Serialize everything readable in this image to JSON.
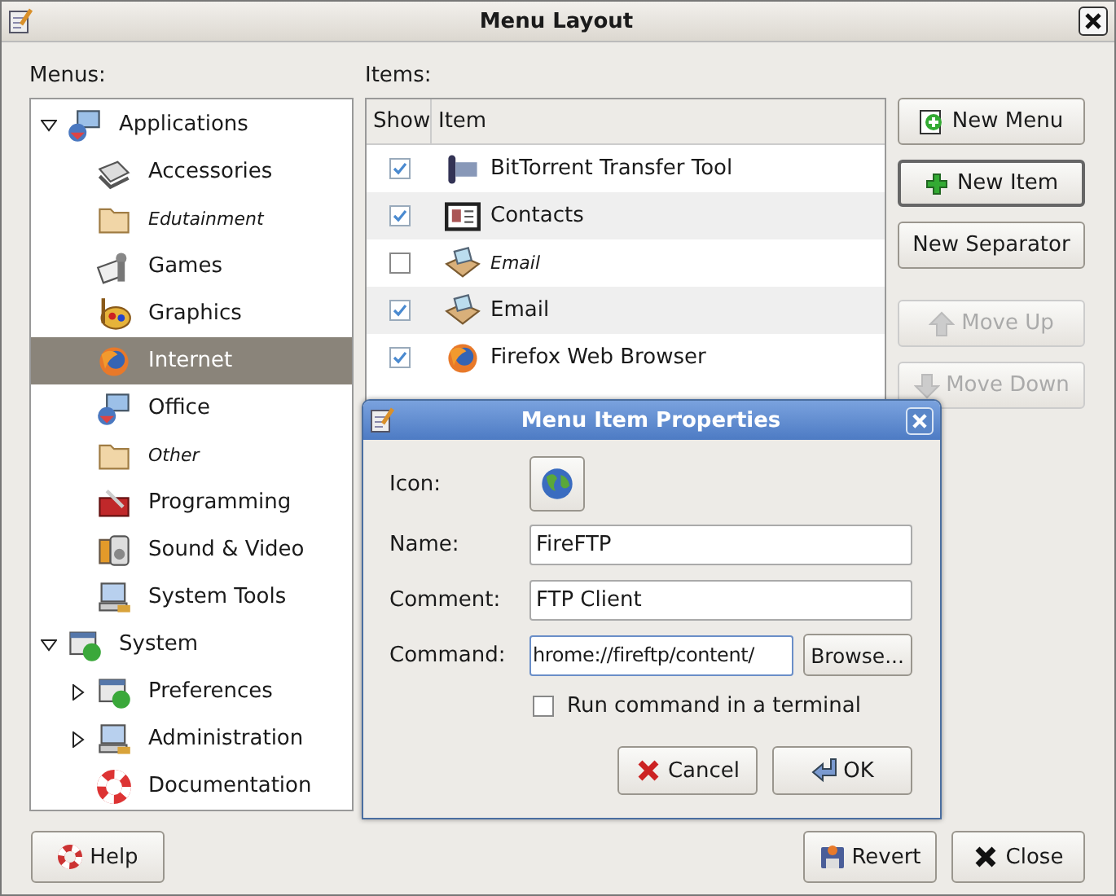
{
  "window": {
    "title": "Menu Layout"
  },
  "menus_label": "Menus:",
  "items_label": "Items:",
  "menus": [
    {
      "name": "Applications",
      "expanded": true,
      "selected": false,
      "hidden": false,
      "children": [
        {
          "name": "Accessories",
          "selected": false,
          "hidden": false
        },
        {
          "name": "Edutainment",
          "selected": false,
          "hidden": true
        },
        {
          "name": "Games",
          "selected": false,
          "hidden": false
        },
        {
          "name": "Graphics",
          "selected": false,
          "hidden": false
        },
        {
          "name": "Internet",
          "selected": true,
          "hidden": false
        },
        {
          "name": "Office",
          "selected": false,
          "hidden": false
        },
        {
          "name": "Other",
          "selected": false,
          "hidden": true
        },
        {
          "name": "Programming",
          "selected": false,
          "hidden": false
        },
        {
          "name": "Sound & Video",
          "selected": false,
          "hidden": false
        },
        {
          "name": "System Tools",
          "selected": false,
          "hidden": false
        }
      ]
    },
    {
      "name": "System",
      "expanded": true,
      "selected": false,
      "hidden": false,
      "children": [
        {
          "name": "Preferences",
          "expanded": false,
          "selected": false,
          "hidden": false
        },
        {
          "name": "Administration",
          "expanded": false,
          "selected": false,
          "hidden": false
        },
        {
          "name": "Documentation",
          "selected": false,
          "hidden": false
        }
      ]
    }
  ],
  "items": {
    "columns": [
      "Show",
      "Item"
    ],
    "rows": [
      {
        "name": "BitTorrent Transfer Tool",
        "show": true,
        "hidden": false
      },
      {
        "name": "Contacts",
        "show": true,
        "hidden": false
      },
      {
        "name": "Email",
        "show": false,
        "hidden": true
      },
      {
        "name": "Email",
        "show": true,
        "hidden": false
      },
      {
        "name": "Firefox Web Browser",
        "show": true,
        "hidden": false
      }
    ]
  },
  "side_buttons": [
    {
      "kind": "new-menu",
      "label": "New Menu",
      "disabled": false
    },
    {
      "kind": "new-item",
      "label": "New Item",
      "disabled": false
    },
    {
      "kind": "separator",
      "label": "New Separator",
      "disabled": false
    },
    {
      "kind": "move-up",
      "label": "Move Up",
      "disabled": true
    },
    {
      "kind": "move-down",
      "label": "Move Down",
      "disabled": true
    }
  ],
  "bottom_buttons": [
    {
      "kind": "help",
      "label": "Help"
    },
    {
      "kind": "revert",
      "label": "Revert"
    },
    {
      "kind": "close",
      "label": "Close"
    }
  ],
  "dialog": {
    "title": "Menu Item Properties",
    "icon_label": "Icon:",
    "fields": [
      {
        "label": "Name:",
        "value": "FireFTP"
      },
      {
        "label": "Comment:",
        "value": "FTP Client"
      },
      {
        "label": "Command:",
        "value": "hrome://fireftp/content/",
        "browse": "Browse..."
      }
    ],
    "terminal": {
      "label": "Run command in a terminal",
      "checked": false
    },
    "buttons": [
      {
        "kind": "cancel",
        "label": "Cancel"
      },
      {
        "kind": "ok",
        "label": "OK"
      }
    ]
  }
}
